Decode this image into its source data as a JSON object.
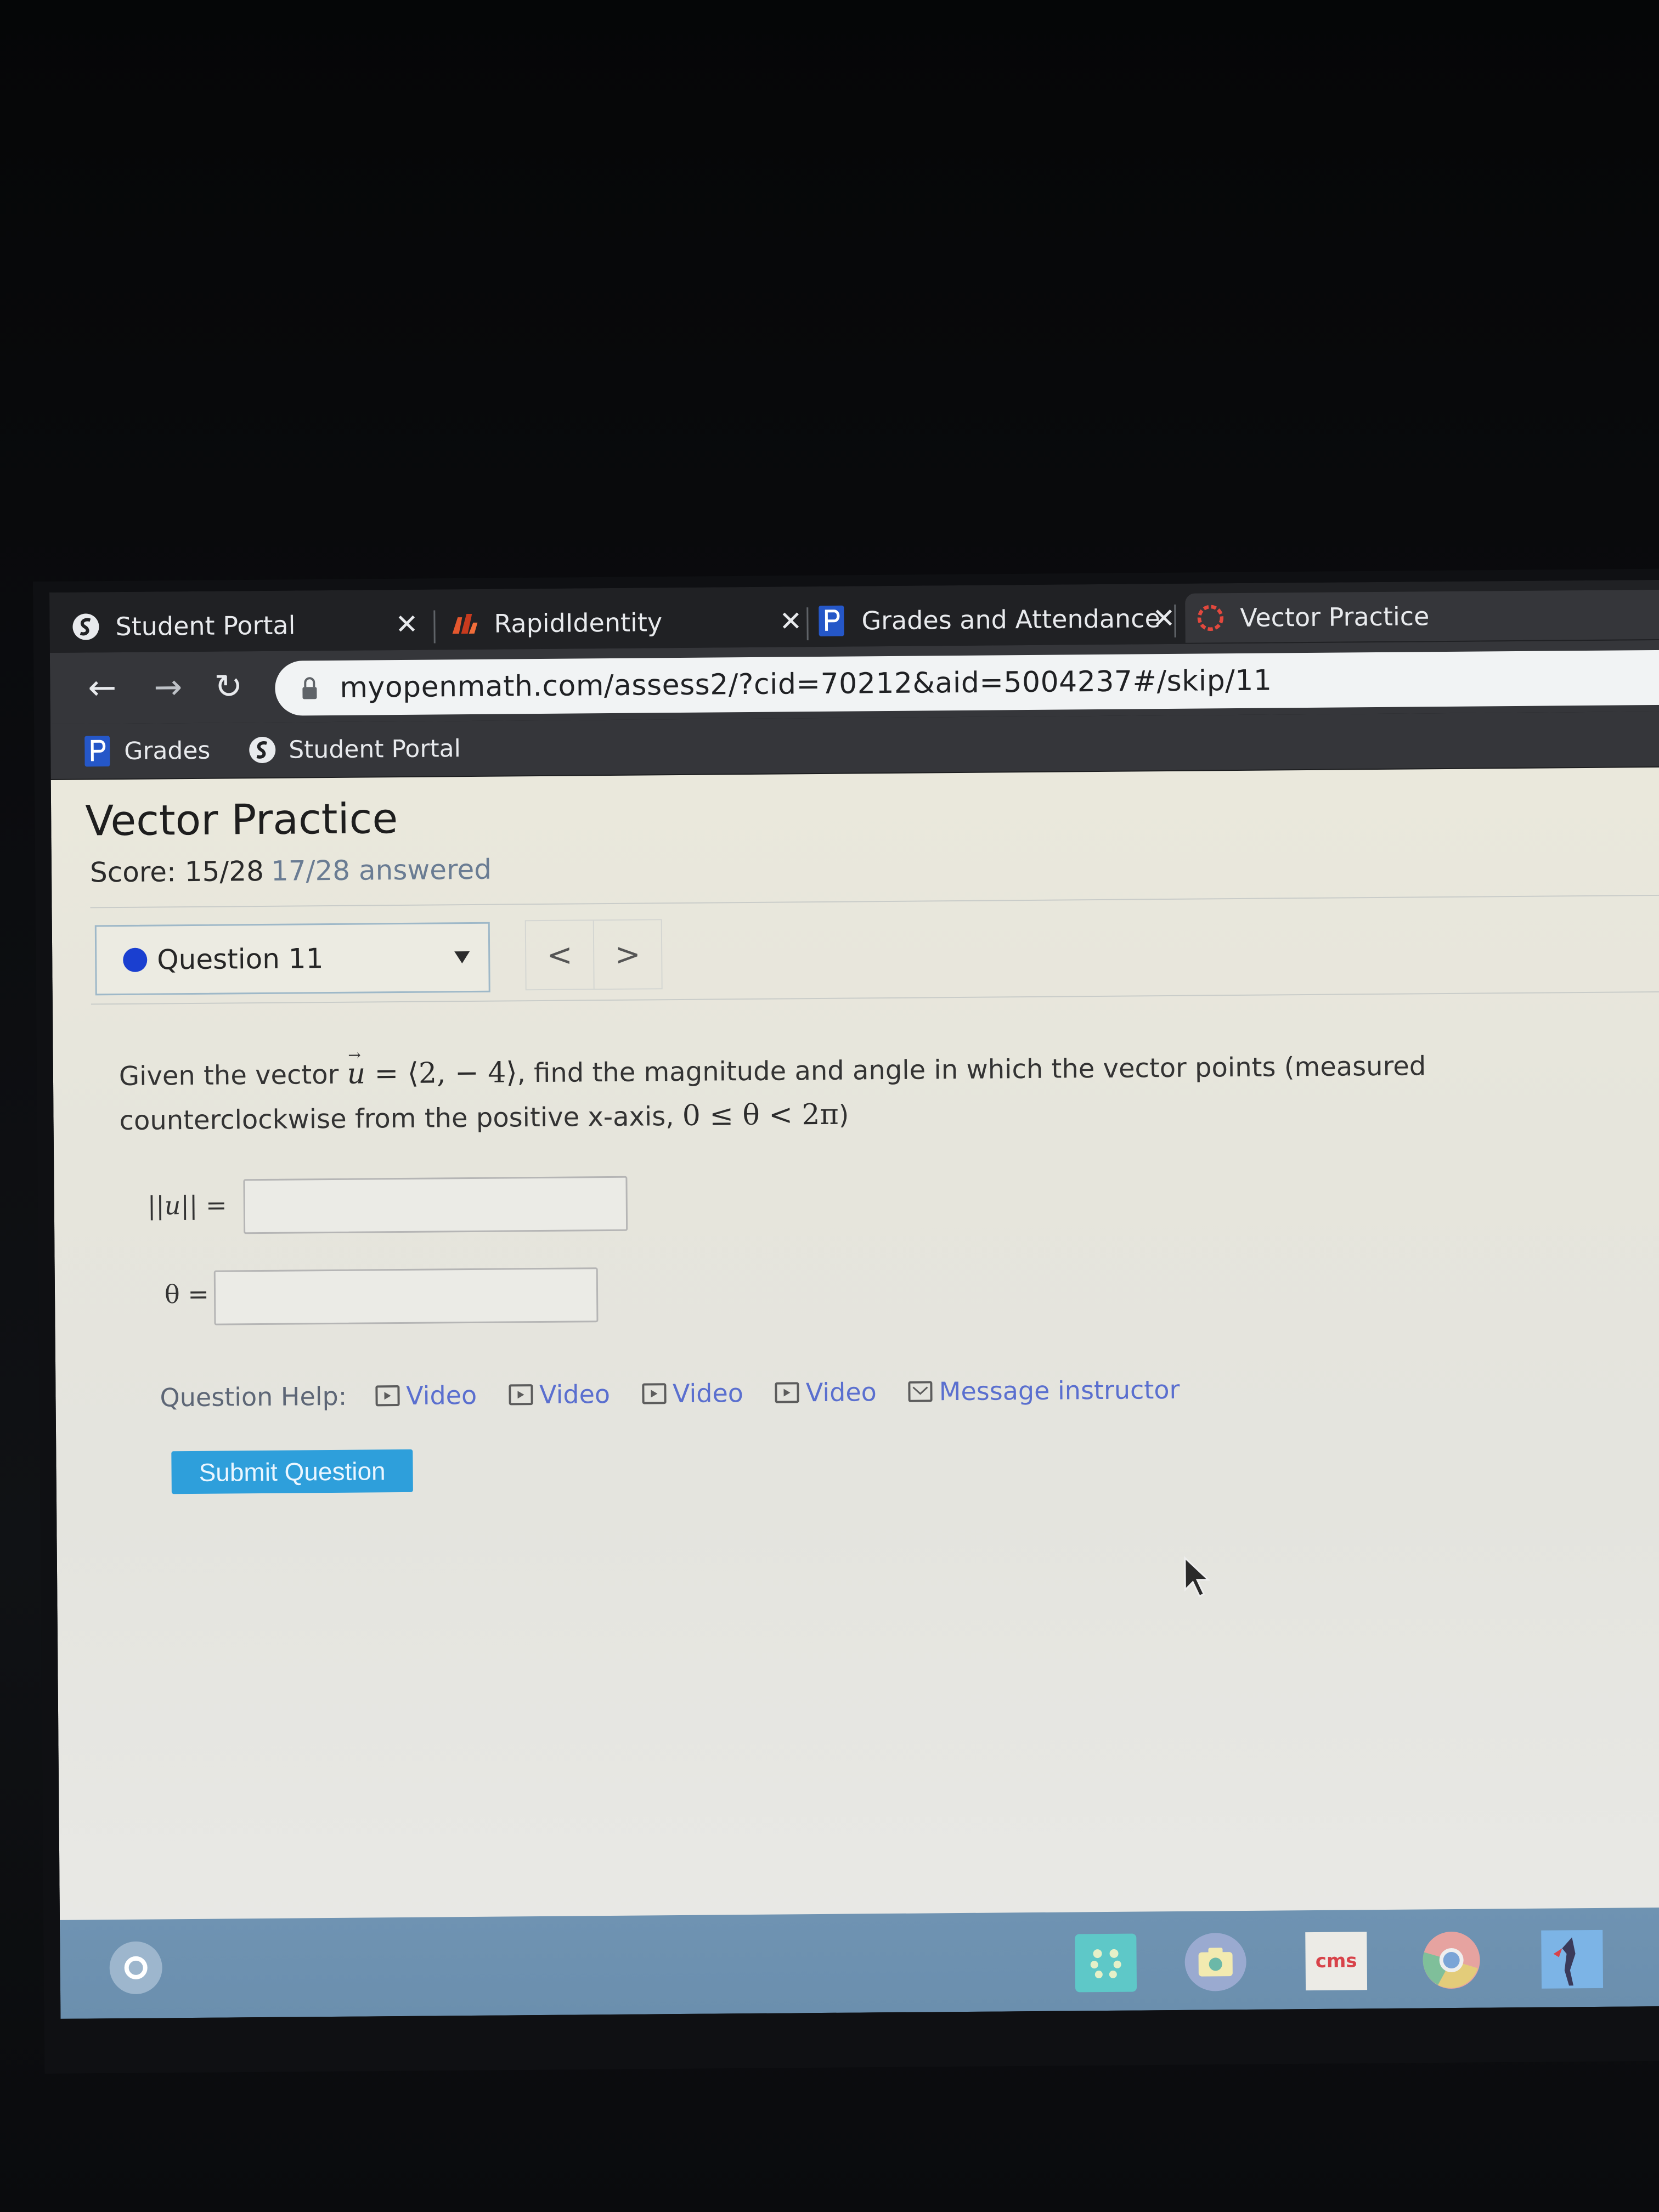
{
  "browser": {
    "tabs": [
      {
        "label": "Student Portal",
        "icon": "globe-s-icon",
        "active": false
      },
      {
        "label": "RapidIdentity",
        "icon": "rapididentity-icon",
        "active": false
      },
      {
        "label": "Grades and Attendance",
        "icon": "powerschool-p-icon",
        "active": false
      },
      {
        "label": "Vector Practice",
        "icon": "myopenmath-ring-icon",
        "active": true
      }
    ],
    "tab_close_glyph": "✕",
    "nav": {
      "back": "←",
      "forward": "→",
      "reload": "↻"
    },
    "url": "myopenmath.com/assess2/?cid=70212&aid=5004237#/skip/11",
    "bookmarks": [
      {
        "label": "Grades",
        "icon": "powerschool-p-icon"
      },
      {
        "label": "Student Portal",
        "icon": "globe-s-icon"
      }
    ]
  },
  "page": {
    "title": "Vector Practice",
    "score": "Score: 15/28",
    "answered": "17/28 answered",
    "question_select": {
      "label": "Question 11",
      "status_color": "#1a3fd0"
    },
    "prev_label": "<",
    "next_label": ">",
    "question": {
      "text_1": "Given the vector ",
      "vec": "u",
      "eq": " = ⟨2,  − 4⟩",
      "text_2": ", find the magnitude and angle in which the vector points (measured counterclockwise from the positive x-axis, ",
      "range": "0 ≤ θ < 2π",
      "text_3": ")"
    },
    "answers": [
      {
        "label_pre": "||",
        "label_vec": "u",
        "label_post": "|| =",
        "value": "",
        "placeholder": ""
      },
      {
        "label": "θ =",
        "value": "",
        "placeholder": ""
      }
    ],
    "help": {
      "label": "Question Help:",
      "links": [
        {
          "label": "Video",
          "icon": "video-icon"
        },
        {
          "label": "Video",
          "icon": "video-icon"
        },
        {
          "label": "Video",
          "icon": "video-icon"
        },
        {
          "label": "Video",
          "icon": "video-icon"
        },
        {
          "label": "Message instructor",
          "icon": "mail-icon"
        }
      ]
    },
    "submit_label": "Submit Question"
  },
  "shelf": {
    "apps": [
      {
        "name": "app-launcher-dots",
        "label": ""
      },
      {
        "name": "camera",
        "label": ""
      },
      {
        "name": "cms",
        "label": "cms"
      },
      {
        "name": "chrome",
        "label": ""
      },
      {
        "name": "game",
        "label": ""
      }
    ]
  },
  "colors": {
    "accent_button": "#2e9fdb",
    "link": "#5a6fcf",
    "status_dot": "#1a3fd0",
    "chrome_dark": "#35363a",
    "shelf": "#6f93b2"
  }
}
